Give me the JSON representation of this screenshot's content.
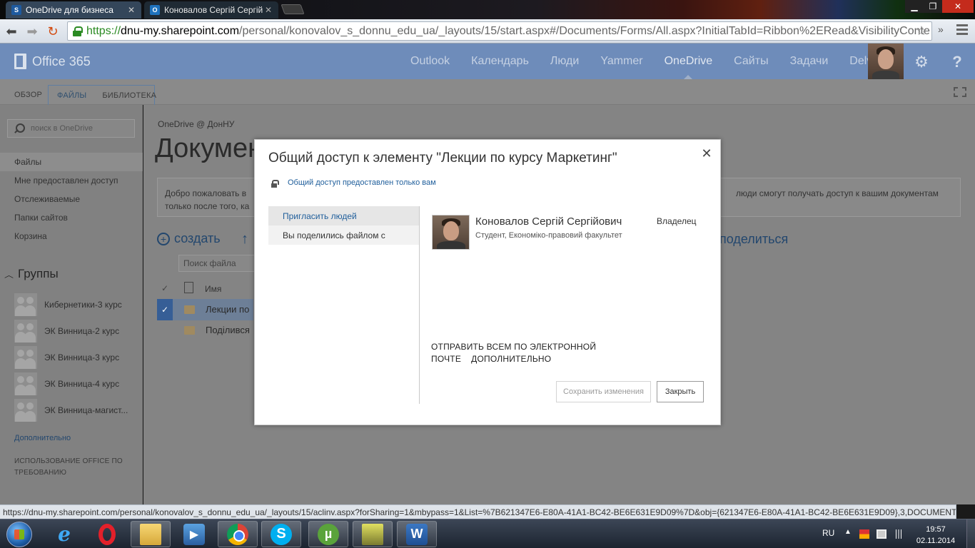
{
  "browser": {
    "tabs": [
      {
        "title": "OneDrive для бизнеса",
        "favicon": "S"
      },
      {
        "title": "Коновалов Сергій Сергій",
        "favicon": "O"
      }
    ],
    "url": {
      "scheme": "https://",
      "host": "dnu-my.sharepoint.com",
      "path": "/personal/konovalov_s_donnu_edu_ua/_layouts/15/start.aspx#/Documents/Forms/All.aspx?InitialTabId=Ribbon%2ERead&VisibilityConte"
    },
    "status_url": "https://dnu-my.sharepoint.com/personal/konovalov_s_donnu_edu_ua/_layouts/15/aclinv.aspx?forSharing=1&mbypass=1&List=%7B621347E6-E80A-41A1-BC42-BE6E631E9D09%7D&obj={621347E6-E80A-41A1-BC42-BE6E631E9D09},3,DOCUMENT&tts=..."
  },
  "o365": {
    "brand": "Office 365",
    "nav": [
      "Outlook",
      "Календарь",
      "Люди",
      "Yammer",
      "OneDrive",
      "Сайты",
      "Задачи",
      "Delve"
    ],
    "active_nav": "OneDrive",
    "help": "?"
  },
  "ribbon": {
    "tabs": [
      "ОБЗОР",
      "ФАЙЛЫ",
      "БИБЛИОТЕКА"
    ],
    "active": "ФАЙЛЫ"
  },
  "leftnav": {
    "search_placeholder": "поиск в OneDrive",
    "items": [
      "Файлы",
      "Мне предоставлен доступ",
      "Отслеживаемые",
      "Папки сайтов",
      "Корзина"
    ],
    "groups_header": "Группы",
    "groups": [
      "Кибернетики-3 курс",
      "ЭК Винница-2 курс",
      "ЭК Винница-3 курс",
      "ЭК Винница-4 курс",
      "ЭК Винница-магист..."
    ],
    "more": "Дополнительно",
    "office_use": "ИСПОЛЬЗОВАНИЕ OFFICE ПО ТРЕБОВАНИЮ"
  },
  "main": {
    "breadcrumb": "OneDrive @ ДонНУ",
    "title": "Докумен",
    "welcome_left": "Добро пожаловать в\nтолько после того, ка",
    "welcome_right": "люди смогут получать доступ к вашим документам",
    "create": "создать",
    "share": "поделиться",
    "file_search_placeholder": "Поиск файла",
    "column_name": "Имя",
    "files": [
      "Лекции по",
      "Поділився з"
    ]
  },
  "dialog": {
    "title": "Общий доступ к элементу \"Лекции по курсу Маркетинг\"",
    "sharing_status": "Общий доступ предоставлен только вам",
    "sidebar": [
      "Пригласить людей",
      "Вы поделились файлом с"
    ],
    "person": {
      "name": "Коновалов Сергій Сергійович",
      "role": "Студент, Економіко-правовий факультет",
      "permission": "Владелец"
    },
    "email_all": "ОТПРАВИТЬ ВСЕМ ПО ЭЛЕКТРОННОЙ ПОЧТЕ",
    "more": "ДОПОЛНИТЕЛЬНО",
    "save_label": "Сохранить изменения",
    "close_label": "Закрыть"
  },
  "taskbar": {
    "lang": "RU",
    "time": "19:57",
    "date": "02.11.2014"
  },
  "colors": {
    "o365_bar": "#6e8cba",
    "link_blue": "#1f5e9b",
    "selected_check": "#365e96"
  }
}
